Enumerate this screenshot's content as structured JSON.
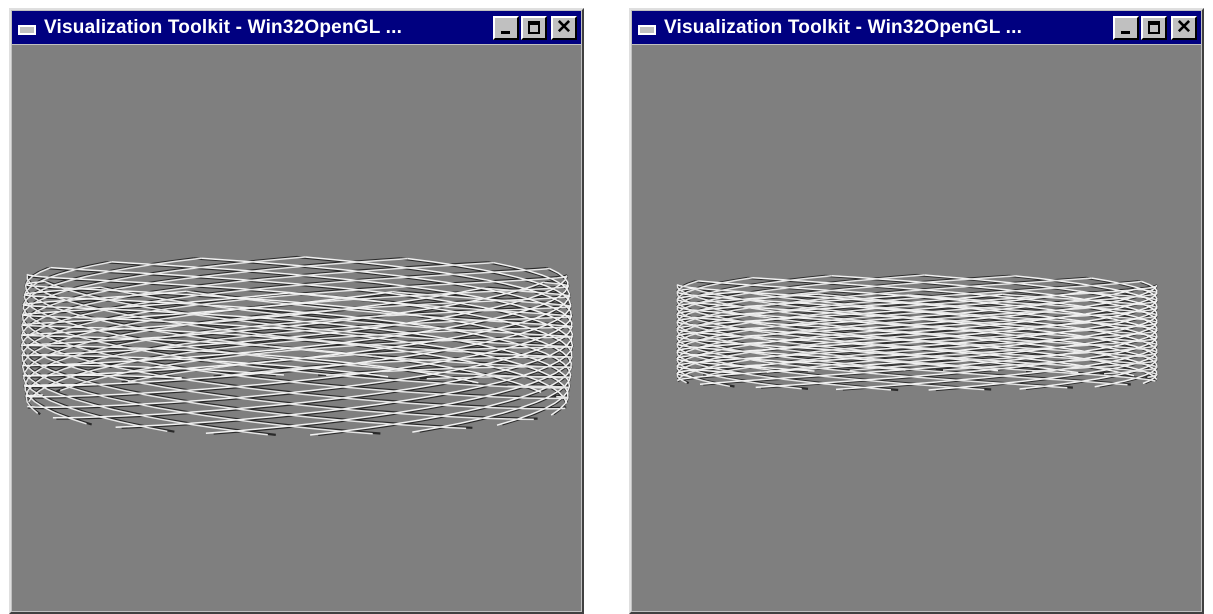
{
  "windows": [
    {
      "id": "left",
      "title": "Visualization Toolkit - Win32OpenGL ...",
      "controls": {
        "minimize": "minimize",
        "maximize": "maximize",
        "close": "close"
      },
      "background_color": "#7f7f7f",
      "content": "wireframe-cylinder-perspective"
    },
    {
      "id": "right",
      "title": "Visualization Toolkit - Win32OpenGL ...",
      "controls": {
        "minimize": "minimize",
        "maximize": "maximize",
        "close": "close"
      },
      "background_color": "#7f7f7f",
      "content": "wireframe-cylinder-parallel"
    }
  ],
  "colors": {
    "titlebar": "#000080",
    "frame": "#c0c0c0",
    "viewport": "#7f7f7f"
  }
}
